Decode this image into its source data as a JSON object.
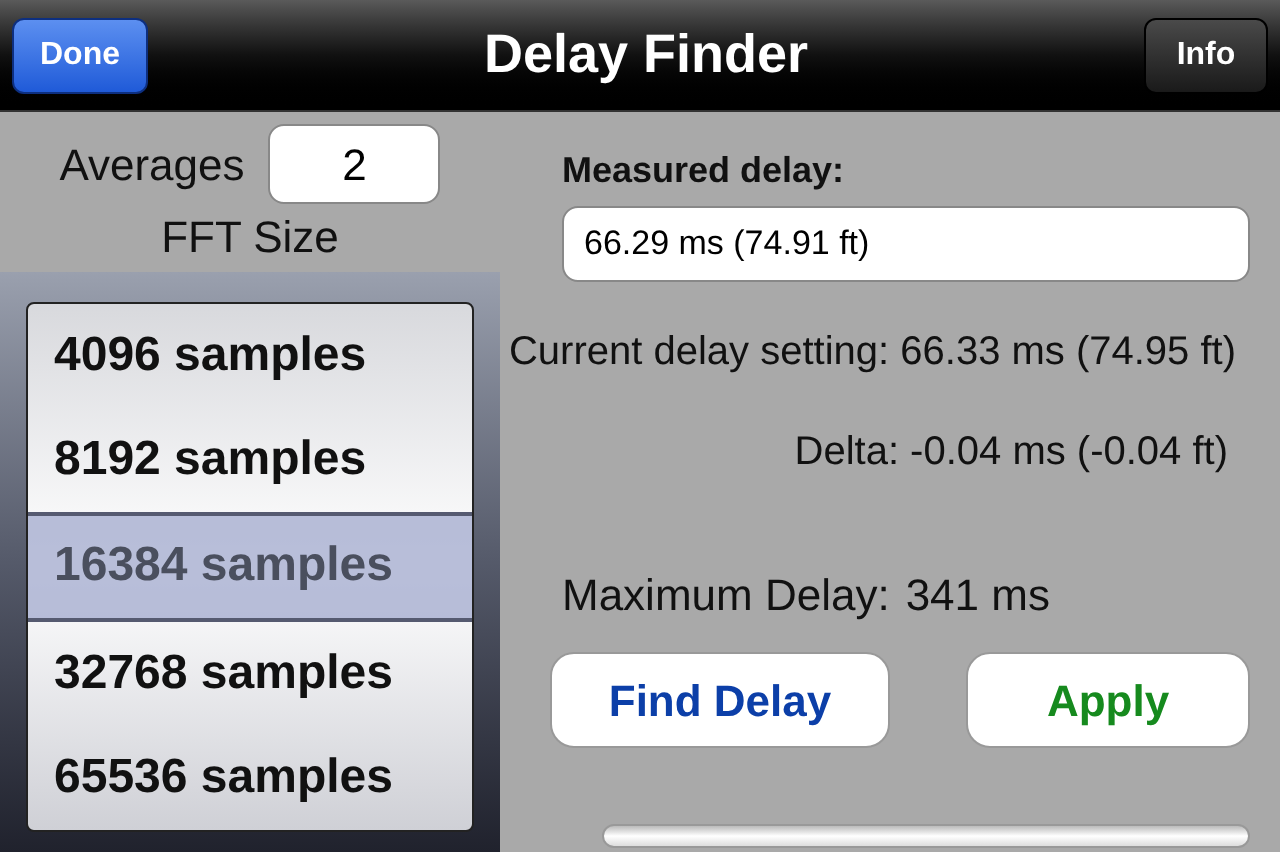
{
  "nav_bar": {
    "title": "Delay Finder",
    "left_button": "Done",
    "right_button": "Info"
  },
  "averages": {
    "label": "Averages",
    "value": "2"
  },
  "fft_size": {
    "label": "FFT Size",
    "options": [
      {
        "label": "4096 samples",
        "selected": false
      },
      {
        "label": "8192 samples",
        "selected": false
      },
      {
        "label": "16384 samples",
        "selected": true
      },
      {
        "label": "32768 samples",
        "selected": false
      },
      {
        "label": "65536 samples",
        "selected": false
      }
    ]
  },
  "measured_delay": {
    "label": "Measured delay:",
    "value": "66.29 ms (74.91 ft)"
  },
  "current_delay": "Current delay setting: 66.33 ms (74.95 ft)",
  "delta": "Delta: -0.04 ms (-0.04 ft)",
  "maximum_delay": {
    "label": "Maximum Delay:",
    "value": "341 ms"
  },
  "buttons": [
    {
      "label": "Find Delay",
      "color": "#0c3fa8"
    },
    {
      "label": "Apply",
      "color": "#168a1e"
    }
  ],
  "progress": {
    "level": 0
  }
}
